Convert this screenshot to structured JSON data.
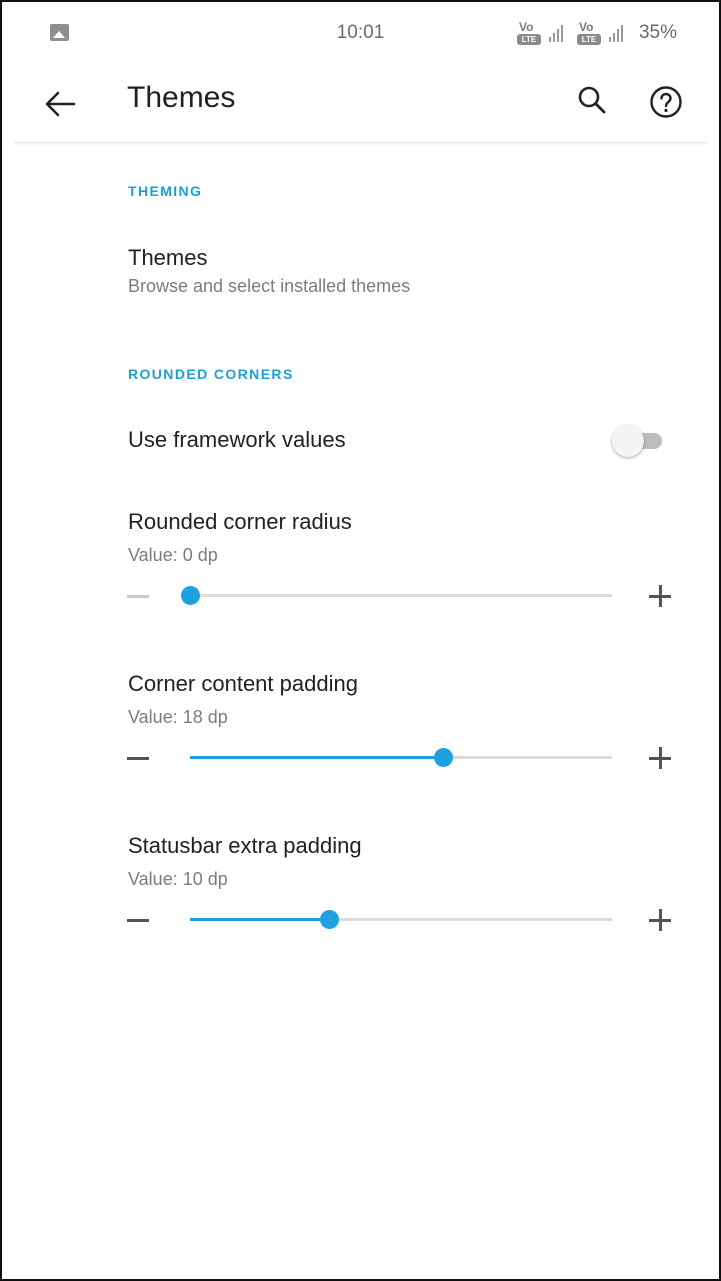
{
  "status_bar": {
    "time": "10:01",
    "volte_label": "Vo",
    "lte_label": "LTE",
    "battery": "35%",
    "icons": [
      "gallery-icon",
      "volte-icon",
      "signal-icon",
      "volte-icon",
      "signal-icon"
    ]
  },
  "app_bar": {
    "title": "Themes",
    "icons": [
      "back-arrow-icon",
      "search-icon",
      "help-icon"
    ]
  },
  "sections": {
    "theming": {
      "header": "THEMING",
      "themes_item": {
        "title": "Themes",
        "subtitle": "Browse and select installed themes"
      }
    },
    "rounded_corners": {
      "header": "ROUNDED CORNERS",
      "use_framework": {
        "title": "Use framework values",
        "enabled": false
      },
      "corner_radius": {
        "title": "Rounded corner radius",
        "value_text": "Value: 0 dp",
        "value": 0,
        "position": 0.0
      },
      "content_padding": {
        "title": "Corner content padding",
        "value_text": "Value: 18 dp",
        "value": 18,
        "position": 0.6
      },
      "statusbar_padding": {
        "title": "Statusbar extra padding",
        "value_text": "Value: 10 dp",
        "value": 10,
        "position": 0.33
      }
    }
  },
  "colors": {
    "accent": "#1ea2df",
    "section_header": "#1e9ed2",
    "text_primary": "#202124",
    "text_secondary": "#7c7c7c"
  }
}
